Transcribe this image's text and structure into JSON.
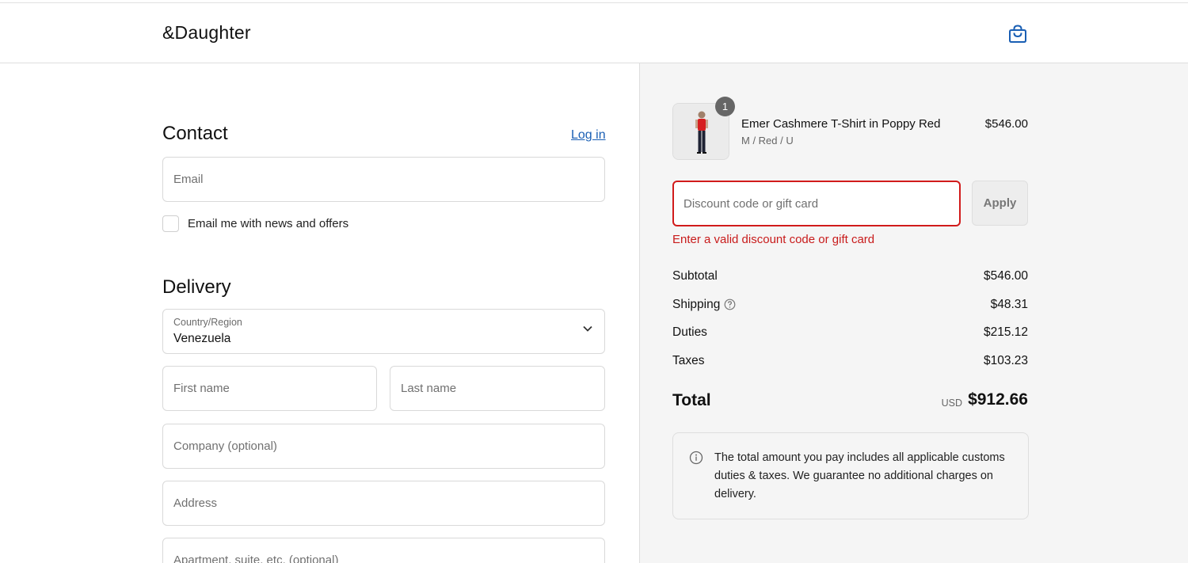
{
  "header": {
    "brand": "&Daughter"
  },
  "contact": {
    "title": "Contact",
    "login_label": "Log in",
    "email_placeholder": "Email",
    "newsletter_label": "Email me with news and offers",
    "newsletter_checked": false
  },
  "delivery": {
    "title": "Delivery",
    "country_label": "Country/Region",
    "country_value": "Venezuela",
    "first_name_placeholder": "First name",
    "last_name_placeholder": "Last name",
    "company_placeholder": "Company (optional)",
    "address_placeholder": "Address",
    "apartment_placeholder": "Apartment, suite, etc. (optional)"
  },
  "summary": {
    "product": {
      "quantity": "1",
      "name": "Emer Cashmere T-Shirt in Poppy Red",
      "variant": "M / Red / U",
      "price": "$546.00"
    },
    "discount": {
      "placeholder": "Discount code or gift card",
      "apply_label": "Apply",
      "error": "Enter a valid discount code or gift card"
    },
    "rows": {
      "subtotal_label": "Subtotal",
      "subtotal_value": "$546.00",
      "shipping_label": "Shipping",
      "shipping_value": "$48.31",
      "duties_label": "Duties",
      "duties_value": "$215.12",
      "taxes_label": "Taxes",
      "taxes_value": "$103.23"
    },
    "total": {
      "label": "Total",
      "currency": "USD",
      "value": "$912.66"
    },
    "notice": "The total amount you pay includes all applicable customs duties & taxes. We guarantee no additional charges on delivery."
  },
  "colors": {
    "link": "#1a5fb4",
    "error": "#c81b1b",
    "summary_bg": "#f5f5f5",
    "bag_icon": "#1a5fb4"
  },
  "icons": [
    "shopping-bag-icon",
    "chevron-down-icon",
    "help-circle-icon",
    "info-icon"
  ]
}
